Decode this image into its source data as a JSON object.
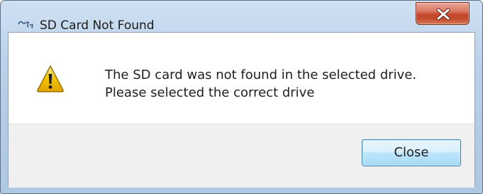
{
  "dialog": {
    "title": "SD Card Not Found",
    "app_icon": "app-logo-icon",
    "close_icon": "close-icon",
    "warning_icon": "warning-icon",
    "message_line1": "The SD card was not found in the selected drive.",
    "message_line2": "Please selected the correct drive",
    "close_button_label": "Close"
  },
  "colors": {
    "titlebar": "#bcd2ea",
    "close_x": "#c6472b",
    "warning_yellow": "#f5c400",
    "button_border": "#3c7fb1"
  }
}
